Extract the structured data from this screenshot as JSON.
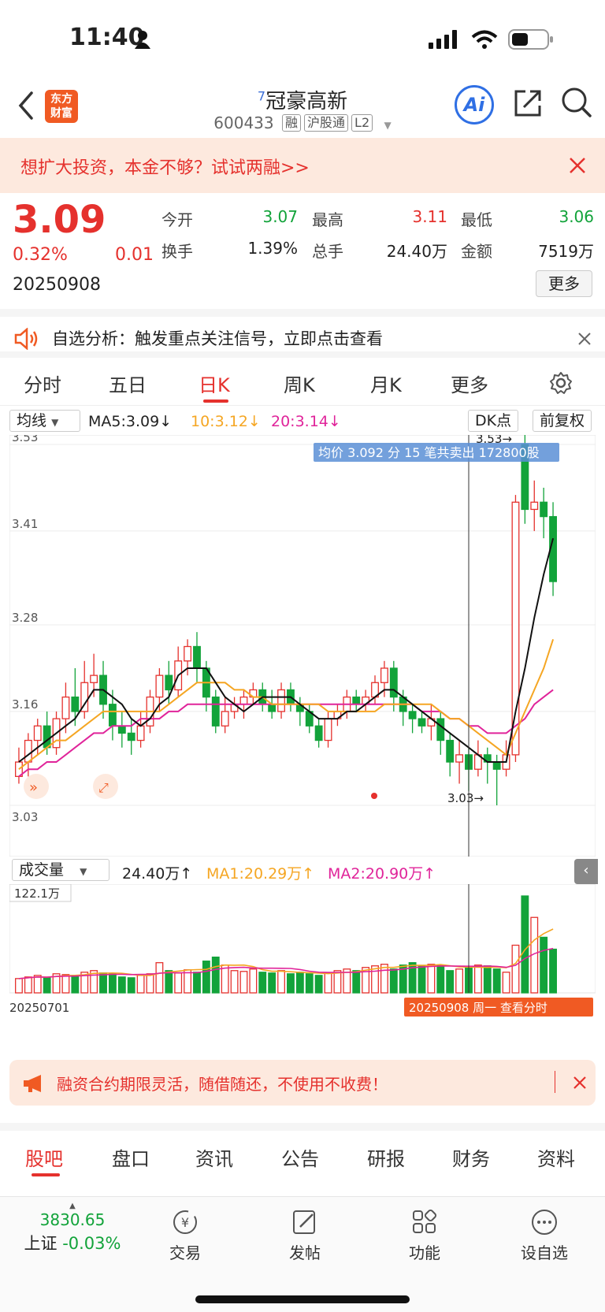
{
  "status_bar": {
    "time": "11:40"
  },
  "header": {
    "logo_text_1": "东方",
    "logo_text_2": "财富",
    "superscript": "7",
    "stock_name": "冠豪高新",
    "stock_code": "600433",
    "tags": [
      "融",
      "沪股通",
      "L2"
    ],
    "ai_label": "Ai"
  },
  "promo": {
    "text": "想扩大投资，本金不够？试试两融>>"
  },
  "quote": {
    "price": "3.09",
    "change_pct": "0.32%",
    "change": "0.01",
    "date": "20250908",
    "fields": [
      {
        "label": "今开",
        "value": "3.07",
        "color": "#12a33a"
      },
      {
        "label": "最高",
        "value": "3.11",
        "color": "#e5312d"
      },
      {
        "label": "最低",
        "value": "3.06",
        "color": "#12a33a"
      },
      {
        "label": "换手",
        "value": "1.39%",
        "color": "#222222"
      },
      {
        "label": "总手",
        "value": "24.40万",
        "color": "#222222"
      },
      {
        "label": "金额",
        "value": "7519万",
        "color": "#222222"
      }
    ],
    "more": "更多"
  },
  "notice": {
    "text": "自选分析：触发重点关注信号，立即点击查看"
  },
  "tabs": [
    "分时",
    "五日",
    "日K",
    "周K",
    "月K",
    "更多"
  ],
  "active_tab": "日K",
  "kline_header": {
    "indicator": "均线",
    "ma5": "MA5:3.09",
    "ma10": "10:3.12",
    "ma20": "20:3.14",
    "dk": "DK点",
    "adjust": "前复权"
  },
  "chart_data": {
    "type": "candlestick",
    "y_ticks": [
      "3.53",
      "3.41",
      "3.28",
      "3.16",
      "3.03"
    ],
    "ylim": [
      3.03,
      3.53
    ],
    "tooltip": "均价 3.092 分 15 笔共卖出 172800股",
    "high_marker": "3.53→",
    "low_marker": "3.03→",
    "candles": [
      [
        3.07,
        3.09,
        3.11,
        3.06
      ],
      [
        3.09,
        3.12,
        3.13,
        3.07
      ],
      [
        3.12,
        3.14,
        3.15,
        3.1
      ],
      [
        3.14,
        3.11,
        3.16,
        3.1
      ],
      [
        3.11,
        3.15,
        3.16,
        3.1
      ],
      [
        3.15,
        3.18,
        3.2,
        3.13
      ],
      [
        3.18,
        3.16,
        3.22,
        3.14
      ],
      [
        3.16,
        3.2,
        3.23,
        3.15
      ],
      [
        3.2,
        3.21,
        3.24,
        3.18
      ],
      [
        3.21,
        3.17,
        3.23,
        3.15
      ],
      [
        3.17,
        3.14,
        3.19,
        3.12
      ],
      [
        3.14,
        3.13,
        3.16,
        3.11
      ],
      [
        3.13,
        3.12,
        3.15,
        3.1
      ],
      [
        3.12,
        3.14,
        3.16,
        3.11
      ],
      [
        3.14,
        3.18,
        3.19,
        3.13
      ],
      [
        3.18,
        3.21,
        3.22,
        3.16
      ],
      [
        3.21,
        3.19,
        3.23,
        3.17
      ],
      [
        3.19,
        3.23,
        3.25,
        3.18
      ],
      [
        3.23,
        3.25,
        3.26,
        3.21
      ],
      [
        3.25,
        3.22,
        3.27,
        3.2
      ],
      [
        3.22,
        3.18,
        3.23,
        3.16
      ],
      [
        3.18,
        3.14,
        3.19,
        3.13
      ],
      [
        3.14,
        3.16,
        3.18,
        3.13
      ],
      [
        3.16,
        3.17,
        3.18,
        3.15
      ],
      [
        3.17,
        3.18,
        3.19,
        3.15
      ],
      [
        3.18,
        3.19,
        3.2,
        3.17
      ],
      [
        3.19,
        3.17,
        3.2,
        3.16
      ],
      [
        3.17,
        3.16,
        3.19,
        3.15
      ],
      [
        3.16,
        3.19,
        3.2,
        3.15
      ],
      [
        3.19,
        3.17,
        3.2,
        3.16
      ],
      [
        3.17,
        3.16,
        3.18,
        3.14
      ],
      [
        3.16,
        3.14,
        3.17,
        3.13
      ],
      [
        3.14,
        3.12,
        3.15,
        3.11
      ],
      [
        3.12,
        3.15,
        3.16,
        3.11
      ],
      [
        3.15,
        3.16,
        3.17,
        3.14
      ],
      [
        3.16,
        3.18,
        3.19,
        3.15
      ],
      [
        3.18,
        3.17,
        3.19,
        3.16
      ],
      [
        3.17,
        3.18,
        3.19,
        3.16
      ],
      [
        3.18,
        3.2,
        3.21,
        3.17
      ],
      [
        3.2,
        3.22,
        3.23,
        3.18
      ],
      [
        3.22,
        3.18,
        3.23,
        3.16
      ],
      [
        3.18,
        3.16,
        3.19,
        3.14
      ],
      [
        3.16,
        3.15,
        3.17,
        3.13
      ],
      [
        3.15,
        3.14,
        3.16,
        3.13
      ],
      [
        3.14,
        3.15,
        3.17,
        3.12
      ],
      [
        3.15,
        3.12,
        3.16,
        3.1
      ],
      [
        3.12,
        3.09,
        3.13,
        3.07
      ],
      [
        3.09,
        3.1,
        3.12,
        3.06
      ],
      [
        3.1,
        3.08,
        3.11,
        3.05
      ],
      [
        3.08,
        3.1,
        3.12,
        3.07
      ],
      [
        3.1,
        3.09,
        3.11,
        3.06
      ],
      [
        3.09,
        3.08,
        3.1,
        3.03
      ],
      [
        3.08,
        3.1,
        3.12,
        3.07
      ],
      [
        3.1,
        3.45,
        3.46,
        3.09
      ],
      [
        3.53,
        3.44,
        3.58,
        3.42
      ],
      [
        3.44,
        3.45,
        3.48,
        3.41
      ],
      [
        3.45,
        3.43,
        3.47,
        3.4
      ],
      [
        3.43,
        3.34,
        3.45,
        3.32
      ]
    ],
    "ma5": [
      3.09,
      3.1,
      3.11,
      3.12,
      3.13,
      3.14,
      3.15,
      3.17,
      3.19,
      3.19,
      3.18,
      3.17,
      3.15,
      3.14,
      3.15,
      3.17,
      3.18,
      3.21,
      3.22,
      3.22,
      3.22,
      3.2,
      3.18,
      3.17,
      3.16,
      3.17,
      3.18,
      3.18,
      3.18,
      3.18,
      3.17,
      3.16,
      3.15,
      3.15,
      3.15,
      3.16,
      3.16,
      3.17,
      3.18,
      3.19,
      3.19,
      3.18,
      3.17,
      3.16,
      3.15,
      3.14,
      3.13,
      3.12,
      3.11,
      3.1,
      3.09,
      3.09,
      3.09,
      3.16,
      3.22,
      3.29,
      3.35,
      3.4
    ],
    "ma10": [
      3.08,
      3.09,
      3.1,
      3.11,
      3.12,
      3.12,
      3.13,
      3.14,
      3.15,
      3.16,
      3.16,
      3.16,
      3.16,
      3.16,
      3.16,
      3.16,
      3.17,
      3.18,
      3.19,
      3.2,
      3.2,
      3.2,
      3.2,
      3.19,
      3.19,
      3.18,
      3.18,
      3.17,
      3.17,
      3.17,
      3.17,
      3.17,
      3.17,
      3.16,
      3.16,
      3.16,
      3.16,
      3.16,
      3.16,
      3.17,
      3.17,
      3.17,
      3.17,
      3.17,
      3.17,
      3.16,
      3.15,
      3.15,
      3.14,
      3.13,
      3.12,
      3.11,
      3.1,
      3.13,
      3.16,
      3.19,
      3.22,
      3.26
    ],
    "ma20": [
      3.07,
      3.08,
      3.08,
      3.09,
      3.09,
      3.1,
      3.11,
      3.12,
      3.13,
      3.13,
      3.14,
      3.14,
      3.14,
      3.15,
      3.15,
      3.15,
      3.16,
      3.16,
      3.17,
      3.17,
      3.17,
      3.17,
      3.17,
      3.17,
      3.17,
      3.17,
      3.17,
      3.17,
      3.17,
      3.17,
      3.17,
      3.17,
      3.17,
      3.17,
      3.17,
      3.17,
      3.17,
      3.17,
      3.17,
      3.17,
      3.17,
      3.17,
      3.17,
      3.16,
      3.16,
      3.16,
      3.15,
      3.15,
      3.14,
      3.14,
      3.13,
      3.13,
      3.13,
      3.14,
      3.15,
      3.17,
      3.18,
      3.19
    ],
    "volume": [
      18,
      20,
      22,
      19,
      24,
      23,
      22,
      26,
      28,
      25,
      24,
      20,
      19,
      22,
      24,
      38,
      28,
      25,
      29,
      26,
      40,
      45,
      35,
      28,
      27,
      30,
      26,
      25,
      28,
      24,
      26,
      24,
      22,
      25,
      28,
      30,
      28,
      32,
      34,
      36,
      30,
      35,
      38,
      34,
      36,
      35,
      28,
      30,
      33,
      35,
      34,
      30,
      26,
      60,
      122,
      95,
      70,
      55
    ],
    "vol_max": "122.1万",
    "date_start": "20250701",
    "date_end_label": "20250908 周一 查看分时"
  },
  "volume_header": {
    "indicator": "成交量",
    "vol": "24.40万",
    "ma1": "MA1:20.29万",
    "ma2": "MA2:20.90万"
  },
  "ad": {
    "text": "融资合约期限灵活，随借随还，不使用不收费！"
  },
  "bottom_tabs": [
    "股吧",
    "盘口",
    "资讯",
    "公告",
    "研报",
    "财务",
    "资料"
  ],
  "bottom_bar": {
    "index_value": "3830.65",
    "index_name": "上证",
    "index_change": "-0.03%",
    "items": [
      "交易",
      "发帖",
      "功能",
      "设自选"
    ]
  }
}
